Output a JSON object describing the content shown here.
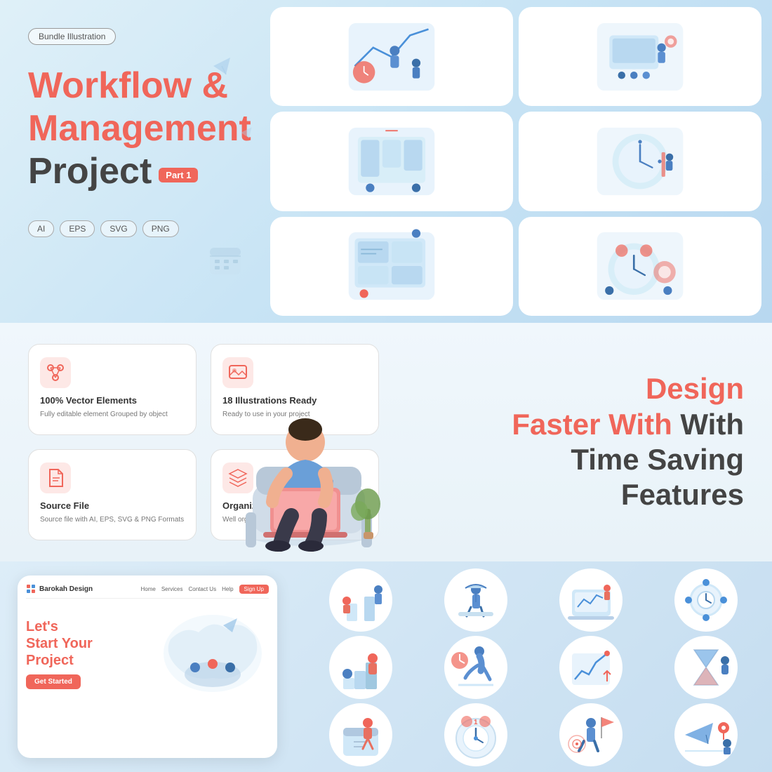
{
  "badge": {
    "label": "Bundle Illustration"
  },
  "title": {
    "line1": "Workflow &",
    "line2": "Management",
    "line3": "Project",
    "part": "Part 1"
  },
  "formats": [
    "AI",
    "EPS",
    "SVG",
    "PNG"
  ],
  "features": [
    {
      "id": "vector",
      "icon": "🎨",
      "title": "100% Vector Elements",
      "desc": "Fully editable element Grouped by object"
    },
    {
      "id": "illustrations",
      "icon": "🖼️",
      "title": "18 Illustrations Ready",
      "desc": "Ready to use in your project"
    },
    {
      "id": "source",
      "icon": "📄",
      "title": "Source File",
      "desc": "Source file with AI, EPS, SVG & PNG Formats"
    },
    {
      "id": "layers",
      "icon": "📚",
      "title": "Organized Layers",
      "desc": "Well organized layers and groups"
    }
  ],
  "design_faster": {
    "line1": "Design",
    "line2": "Faster With",
    "line3": "Time Saving",
    "line4": "Features"
  },
  "mockup": {
    "logo": "Barokah Design",
    "nav_items": [
      "Home",
      "Services",
      "Contact Us",
      "Help"
    ],
    "signup": "Sign Up",
    "heading_line1": "Let's",
    "heading_line2": "Start Your",
    "heading_line3": "Project",
    "cta": "Get Started"
  },
  "colors": {
    "primary": "#f0665a",
    "background_top": "#dff0f8",
    "background_mid": "#f0f7fc",
    "background_bot": "#ddedf8",
    "text_dark": "#444444",
    "text_muted": "#777777"
  }
}
